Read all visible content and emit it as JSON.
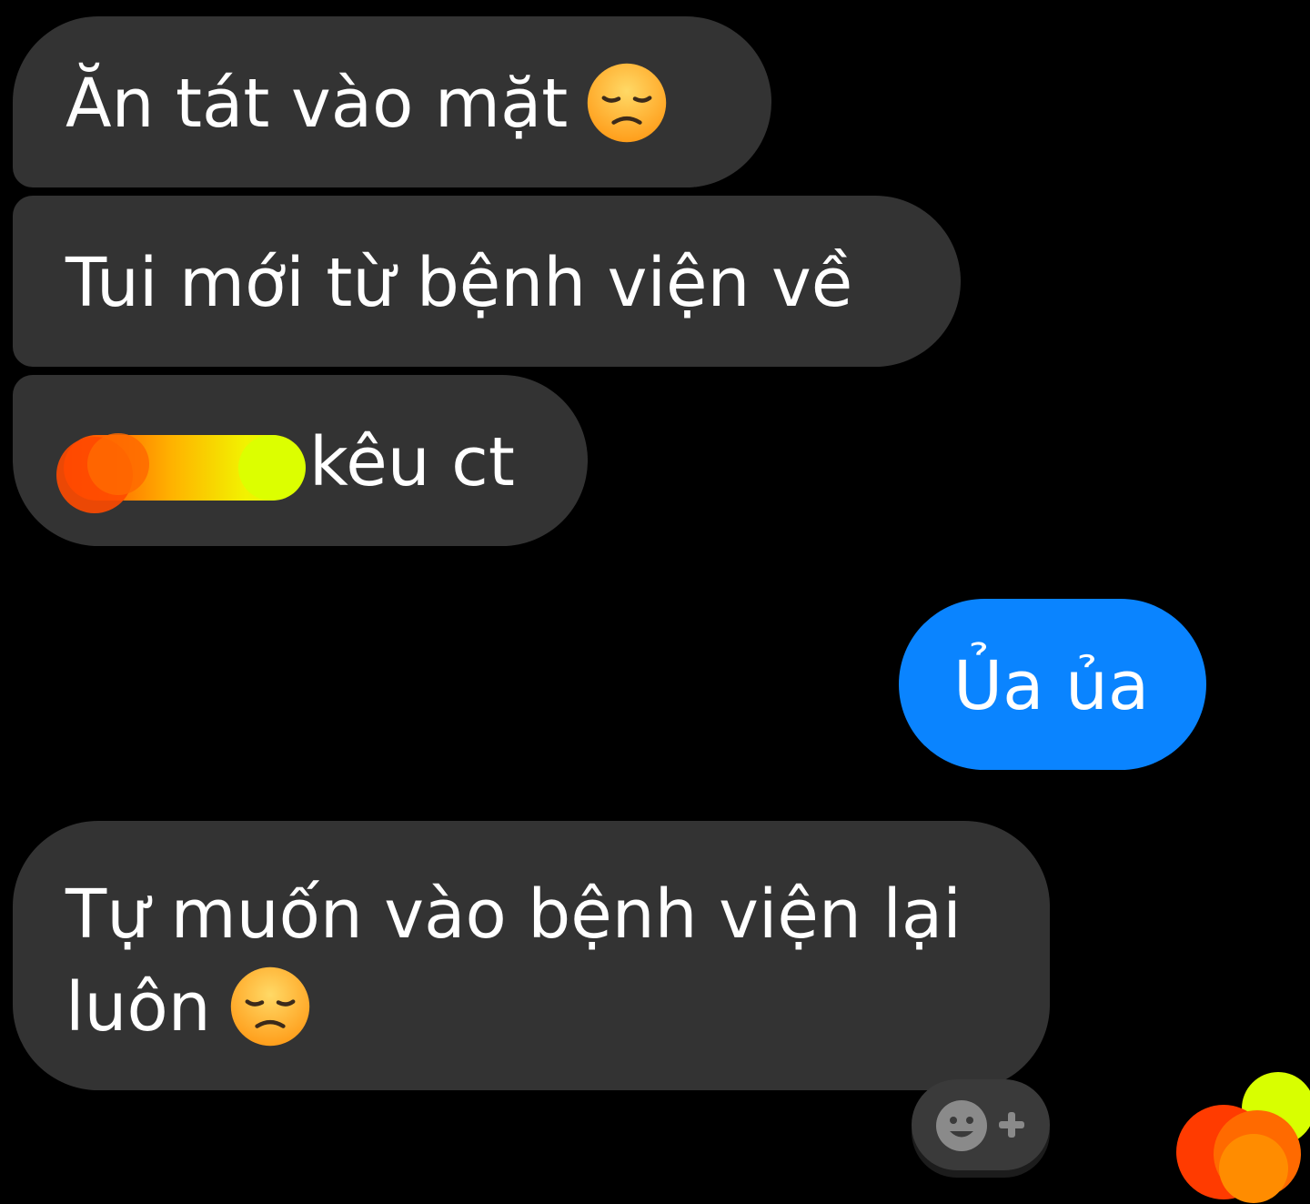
{
  "messages": [
    {
      "id": "b1",
      "side": "incoming",
      "text": "Ăn tát vào mặt",
      "emoji": "disappointed-face-icon"
    },
    {
      "id": "b2",
      "side": "incoming",
      "text": "Tui mới từ bệnh viện về"
    },
    {
      "id": "b3",
      "side": "incoming",
      "text": "kêu ct",
      "redacted_prefix": true
    },
    {
      "id": "b4",
      "side": "outgoing",
      "text": "Ủa ủa"
    },
    {
      "id": "b5",
      "side": "incoming",
      "line1": "Tự muốn vào bệnh viện lại",
      "line2": "luôn",
      "emoji": "disappointed-face-icon"
    }
  ],
  "reaction_button": {
    "icon": "add-reaction-icon"
  },
  "colors": {
    "background": "#000000",
    "incoming_bubble": "#333333",
    "outgoing_bubble": "#0a84ff",
    "text": "#ffffff",
    "emoji_face": "#ffb52e"
  }
}
